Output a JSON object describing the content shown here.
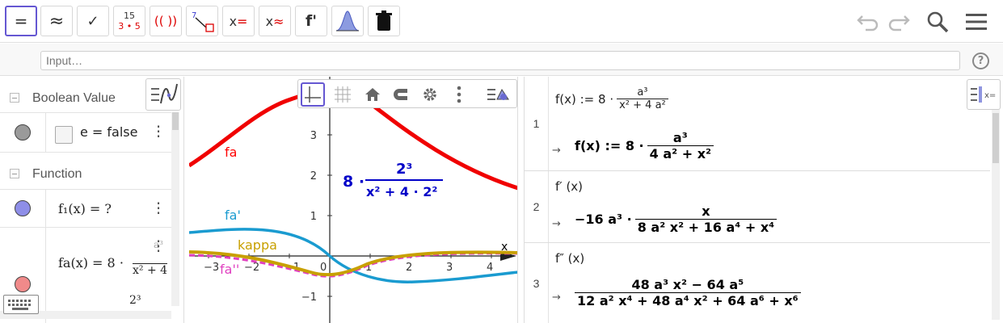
{
  "toolbar": {
    "tools": [
      {
        "name": "evaluate-tool",
        "label": "="
      },
      {
        "name": "numeric-tool",
        "label": "≈"
      },
      {
        "name": "keep-input-tool",
        "label": "✓"
      },
      {
        "name": "factor-numbers-tool",
        "label": "15",
        "sub": "3 • 5"
      },
      {
        "name": "expand-tool",
        "label": "(( ))"
      },
      {
        "name": "substitute-tool",
        "label": "7"
      },
      {
        "name": "solve-tool",
        "label": "x="
      },
      {
        "name": "solve-numerically-tool",
        "label": "x≈"
      },
      {
        "name": "derivative-tool",
        "label": "f'"
      },
      {
        "name": "probability-tool",
        "label": ""
      },
      {
        "name": "delete-tool",
        "label": ""
      }
    ]
  },
  "input": {
    "placeholder": "Input…"
  },
  "algebra": {
    "categories": [
      "Boolean Value",
      "Function"
    ],
    "boolean_item": "e = false",
    "function_items": [
      "f₁(x) = ?",
      "fa(x) = 8 ·"
    ],
    "partial_den": "x² + 4",
    "partial_num_top": "a³",
    "partial_bottom": "2³"
  },
  "graphics": {
    "labels": [
      "fa",
      "fa'",
      "kappa",
      "fa''"
    ],
    "label_colors": [
      "#ff0000",
      "#1a9bd0",
      "#c8a000",
      "#e040c0"
    ],
    "expr_prefix": "8 ·",
    "expr_num": "2³",
    "expr_den": "x² + 4 · 2²",
    "axis_label_x": "x",
    "x_ticks": [
      "−3",
      "−2",
      "−1",
      "0",
      "1",
      "2",
      "3",
      "4"
    ],
    "y_ticks": [
      "3",
      "2",
      "1",
      "−1"
    ]
  },
  "cas": {
    "rows": [
      {
        "num": "1",
        "input": "f(x) := 8 ·",
        "input_num": "a³",
        "input_den": "x² + 4 a²",
        "output_prefix": "f(x)  :=  8 ·",
        "output_num": "a³",
        "output_den": "4 a² + x²"
      },
      {
        "num": "2",
        "input": "f′ (x)",
        "output_prefix": "−16 a³ ·",
        "output_num": "x",
        "output_den": "8 a² x² + 16 a⁴ + x⁴"
      },
      {
        "num": "3",
        "input": "f″ (x)",
        "output_prefix": "",
        "output_num": "48 a³ x² − 64 a⁵",
        "output_den": "12 a² x⁴ + 48 a⁴ x² + 64 a⁶ + x⁶"
      }
    ]
  }
}
